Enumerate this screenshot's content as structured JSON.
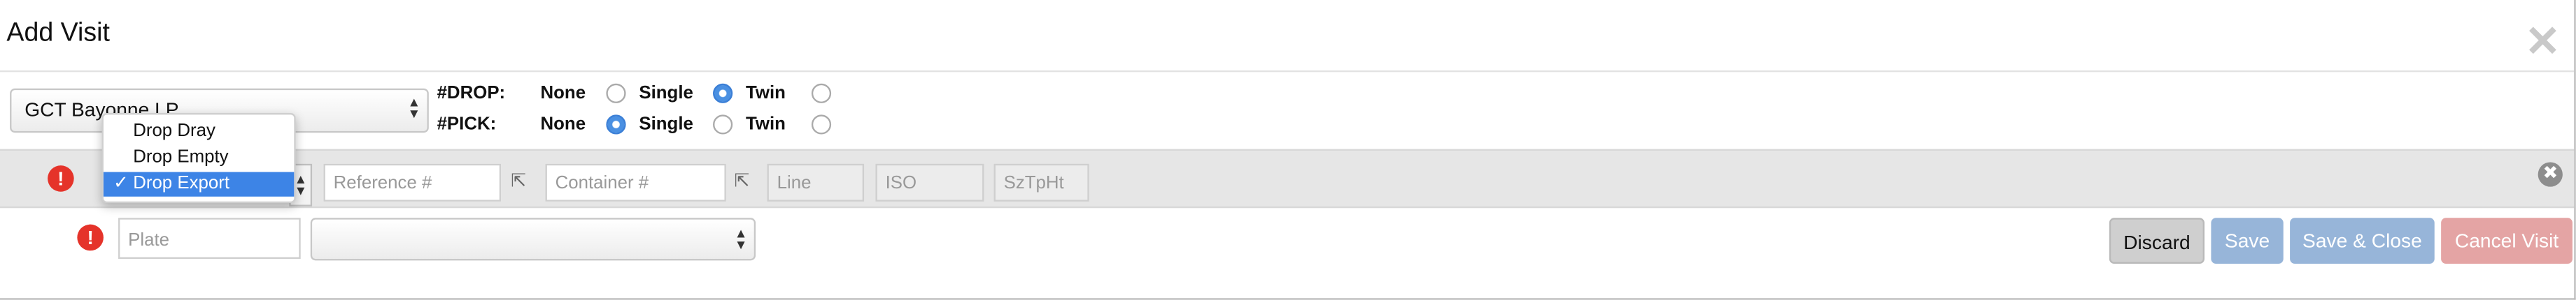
{
  "dialog": {
    "title": "Add Visit",
    "close_glyph": "✕"
  },
  "terminal_select": {
    "value": "GCT Bayonne LP"
  },
  "drop": {
    "label": "#DROP:",
    "options": [
      "None",
      "Single",
      "Twin"
    ],
    "selected": "Single"
  },
  "pick": {
    "label": "#PICK:",
    "options": [
      "None",
      "Single",
      "Twin"
    ],
    "selected": "None"
  },
  "visit_row": {
    "alert_glyph": "!",
    "type_dropdown": {
      "options": [
        "Drop Dray",
        "Drop Empty",
        "Drop Export"
      ],
      "selected": "Drop Export",
      "check_glyph": "✓"
    },
    "reference_placeholder": "Reference #",
    "container_placeholder": "Container #",
    "line_placeholder": "Line",
    "iso_placeholder": "ISO",
    "size_placeholder": "SzTpHt",
    "remove_glyph": "✖"
  },
  "truck_row": {
    "alert_glyph": "!",
    "plate_placeholder": "Plate",
    "secondary_select_value": ""
  },
  "actions": {
    "discard": "Discard",
    "save": "Save",
    "save_close": "Save & Close",
    "cancel": "Cancel Visit"
  },
  "colors": {
    "accent": "#4a90e2",
    "alert": "#e5332a",
    "save_button": "#97b5d9",
    "cancel_button": "#e4a4a4"
  }
}
